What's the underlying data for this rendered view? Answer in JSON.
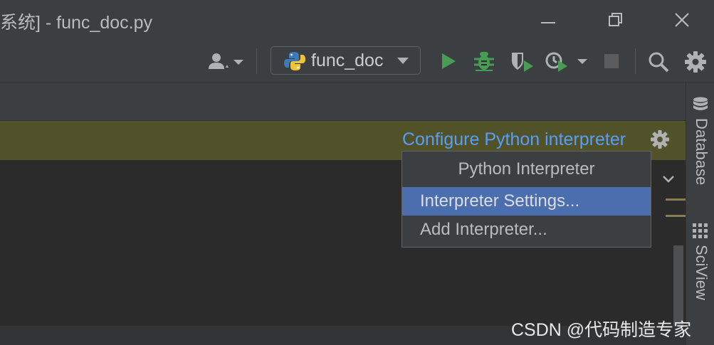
{
  "window": {
    "title": "系统] - func_doc.py"
  },
  "toolbar": {
    "run_config_label": "func_doc"
  },
  "icons": {
    "user": "user-dropdown-icon",
    "python": "python-logo-icon",
    "run": "run-icon",
    "debug": "debug-bug-icon",
    "coverage": "coverage-icon",
    "profile": "profile-icon",
    "stop": "stop-icon",
    "search": "search-icon",
    "settings": "gear-icon"
  },
  "banner": {
    "link_text": "Configure Python interpreter"
  },
  "popup": {
    "title": "Python Interpreter",
    "items": [
      {
        "label": "Interpreter Settings..."
      },
      {
        "label": "Add Interpreter..."
      }
    ]
  },
  "right_panel": {
    "tabs": [
      {
        "label": "Database"
      },
      {
        "label": "SciView"
      }
    ]
  },
  "watermark": {
    "text": "CSDN @代码制造专家"
  },
  "colors": {
    "accent_link": "#589df6",
    "run_green": "#499c54",
    "selection": "#4b6eaf",
    "banner_bg": "#52522a"
  }
}
